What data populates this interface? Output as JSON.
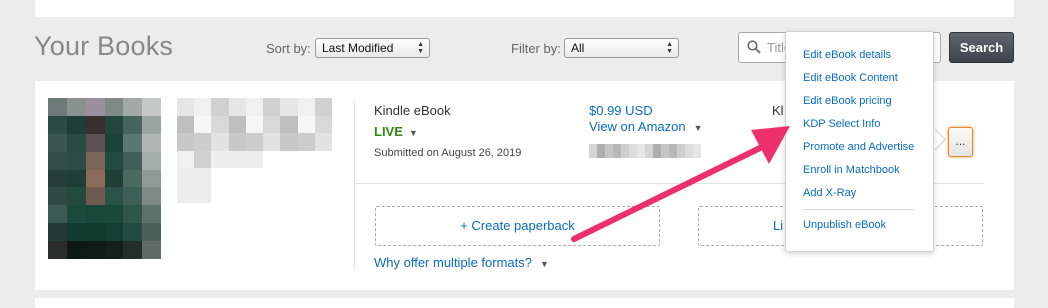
{
  "header": {
    "title": "Your Books",
    "sort_label": "Sort by:",
    "sort_value": "Last Modified",
    "filter_label": "Filter by:",
    "filter_value": "All",
    "search_placeholder": "Title",
    "search_button": "Search"
  },
  "book": {
    "format": "Kindle eBook",
    "status": "LIVE",
    "submitted": "Submitted on August 26, 2019",
    "price": "$0.99 USD",
    "view_link": "View on Amazon",
    "kl_fragment": "Kl",
    "create_paperback": "+ Create paperback",
    "second_button_fragment": "Li",
    "why_link": "Why offer multiple formats?",
    "more_button": "..."
  },
  "menu": {
    "items": [
      "Edit eBook details",
      "Edit eBook Content",
      "Edit eBook pricing",
      "KDP Select Info",
      "Promote and Advertise",
      "Enroll in Matchbook",
      "Add X-Ray",
      "Unpublish eBook"
    ]
  },
  "colors": {
    "link": "#0a6cbf",
    "live_green": "#2e8b10",
    "annotation_pink": "#ee2f6e",
    "focus_orange": "#e8862a"
  },
  "icons": {
    "search": "magnifier-icon",
    "caret": "caret-down-icon",
    "annotation": "annotation-arrow-icon"
  }
}
